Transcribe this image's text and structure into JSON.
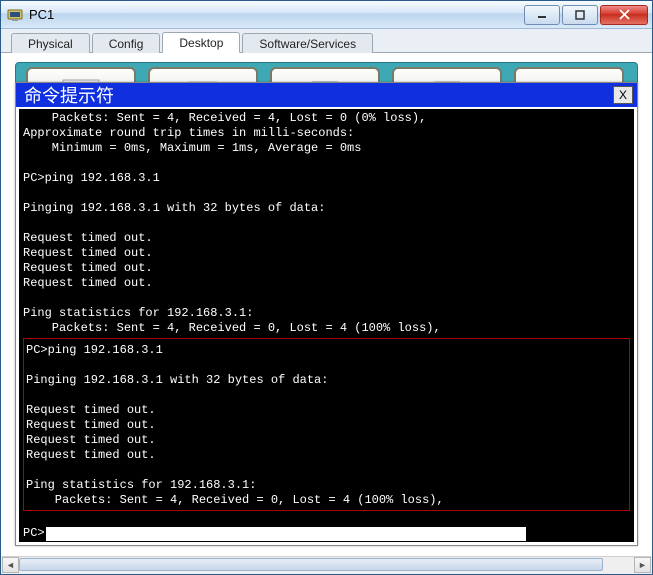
{
  "window": {
    "title": "PC1"
  },
  "win_controls": {
    "min": "–",
    "max": "❐",
    "close": "✕"
  },
  "tabs": {
    "physical": "Physical",
    "config": "Config",
    "desktop": "Desktop",
    "software": "Software/Services",
    "active": "desktop"
  },
  "cmd": {
    "title": "命令提示符",
    "close": "X"
  },
  "terminal": {
    "top_block": "    Packets: Sent = 4, Received = 4, Lost = 0 (0% loss),\nApproximate round trip times in milli-seconds:\n    Minimum = 0ms, Maximum = 1ms, Average = 0ms\n\nPC>ping 192.168.3.1\n\nPinging 192.168.3.1 with 32 bytes of data:\n\nRequest timed out.\nRequest timed out.\nRequest timed out.\nRequest timed out.\n\nPing statistics for 192.168.3.1:\n    Packets: Sent = 4, Received = 0, Lost = 4 (100% loss),\n",
    "highlight_block": "PC>ping 192.168.3.1\n\nPinging 192.168.3.1 with 32 bytes of data:\n\nRequest timed out.\nRequest timed out.\nRequest timed out.\nRequest timed out.\n\nPing statistics for 192.168.3.1:\n    Packets: Sent = 4, Received = 0, Lost = 4 (100% loss),",
    "prompt": "PC>"
  },
  "hscroll": {
    "left": "◄",
    "right": "►"
  }
}
